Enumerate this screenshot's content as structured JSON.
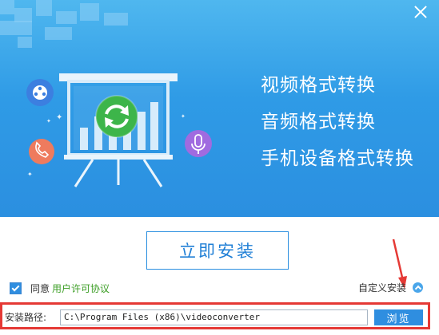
{
  "window": {
    "close_icon": "close-icon"
  },
  "banner": {
    "features": [
      "视频格式转换",
      "音频格式转换",
      "手机设备格式转换"
    ],
    "icons": [
      "film-reel-icon",
      "phone-icon",
      "microphone-icon",
      "refresh-icon",
      "presentation-board-icon"
    ],
    "colors": {
      "background": "#2f9be6",
      "refresh_circle": "#3db54a",
      "mic_circle": "#a06be0",
      "phone_circle": "#ee7b5e",
      "reel_circle": "#3c7fe0"
    }
  },
  "install": {
    "button_label": "立即安装"
  },
  "agreement": {
    "checked": true,
    "text": "同意",
    "link_label": "用户许可协议"
  },
  "custom_install": {
    "label": "自定义安装"
  },
  "install_path": {
    "label": "安装路径:",
    "value": "C:\\Program Files (x86)\\videoconverter",
    "browse_label": "浏览"
  },
  "annotations": {
    "highlight_color": "#e53935"
  }
}
